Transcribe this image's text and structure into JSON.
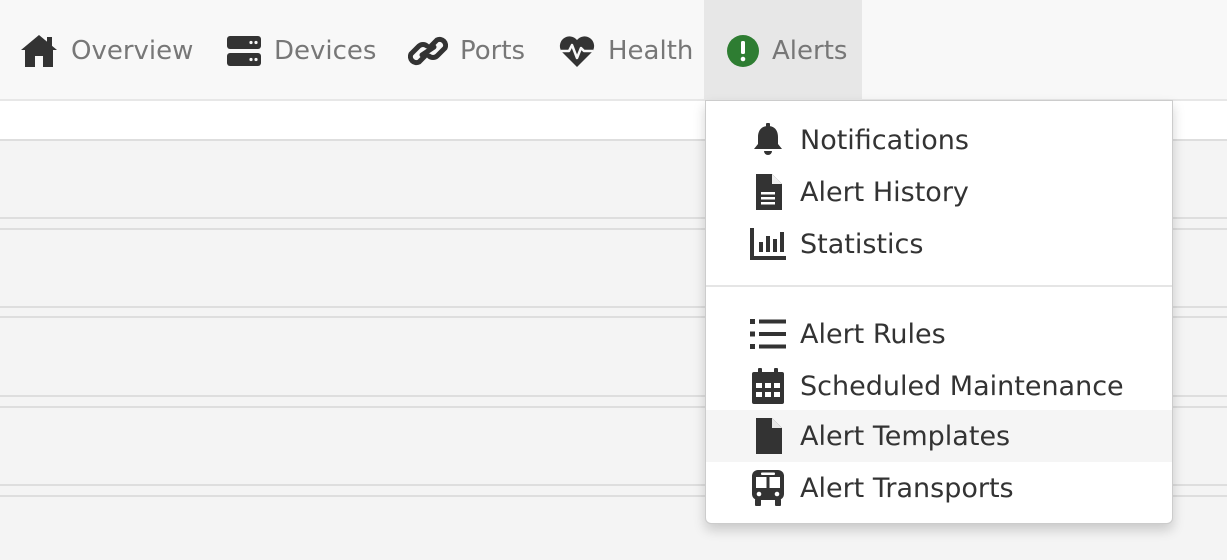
{
  "nav": {
    "items": [
      {
        "label": "Overview",
        "icon": "home-icon"
      },
      {
        "label": "Devices",
        "icon": "server-icon"
      },
      {
        "label": "Ports",
        "icon": "link-icon"
      },
      {
        "label": "Health",
        "icon": "heartbeat-icon"
      },
      {
        "label": "Alerts",
        "icon": "exclamation-circle-icon",
        "active": true
      }
    ],
    "alert_icon_color": "#2e7d32",
    "icon_color": "#333333"
  },
  "alerts_menu": {
    "items": [
      {
        "label": "Notifications",
        "icon": "bell-icon"
      },
      {
        "label": "Alert History",
        "icon": "file-text-icon"
      },
      {
        "label": "Statistics",
        "icon": "bar-chart-icon"
      },
      {
        "label": "Alert Rules",
        "icon": "list-icon"
      },
      {
        "label": "Scheduled Maintenance",
        "icon": "calendar-icon"
      },
      {
        "label": "Alert Templates",
        "icon": "file-icon",
        "hovered": true
      },
      {
        "label": "Alert Transports",
        "icon": "bus-icon"
      }
    ]
  }
}
